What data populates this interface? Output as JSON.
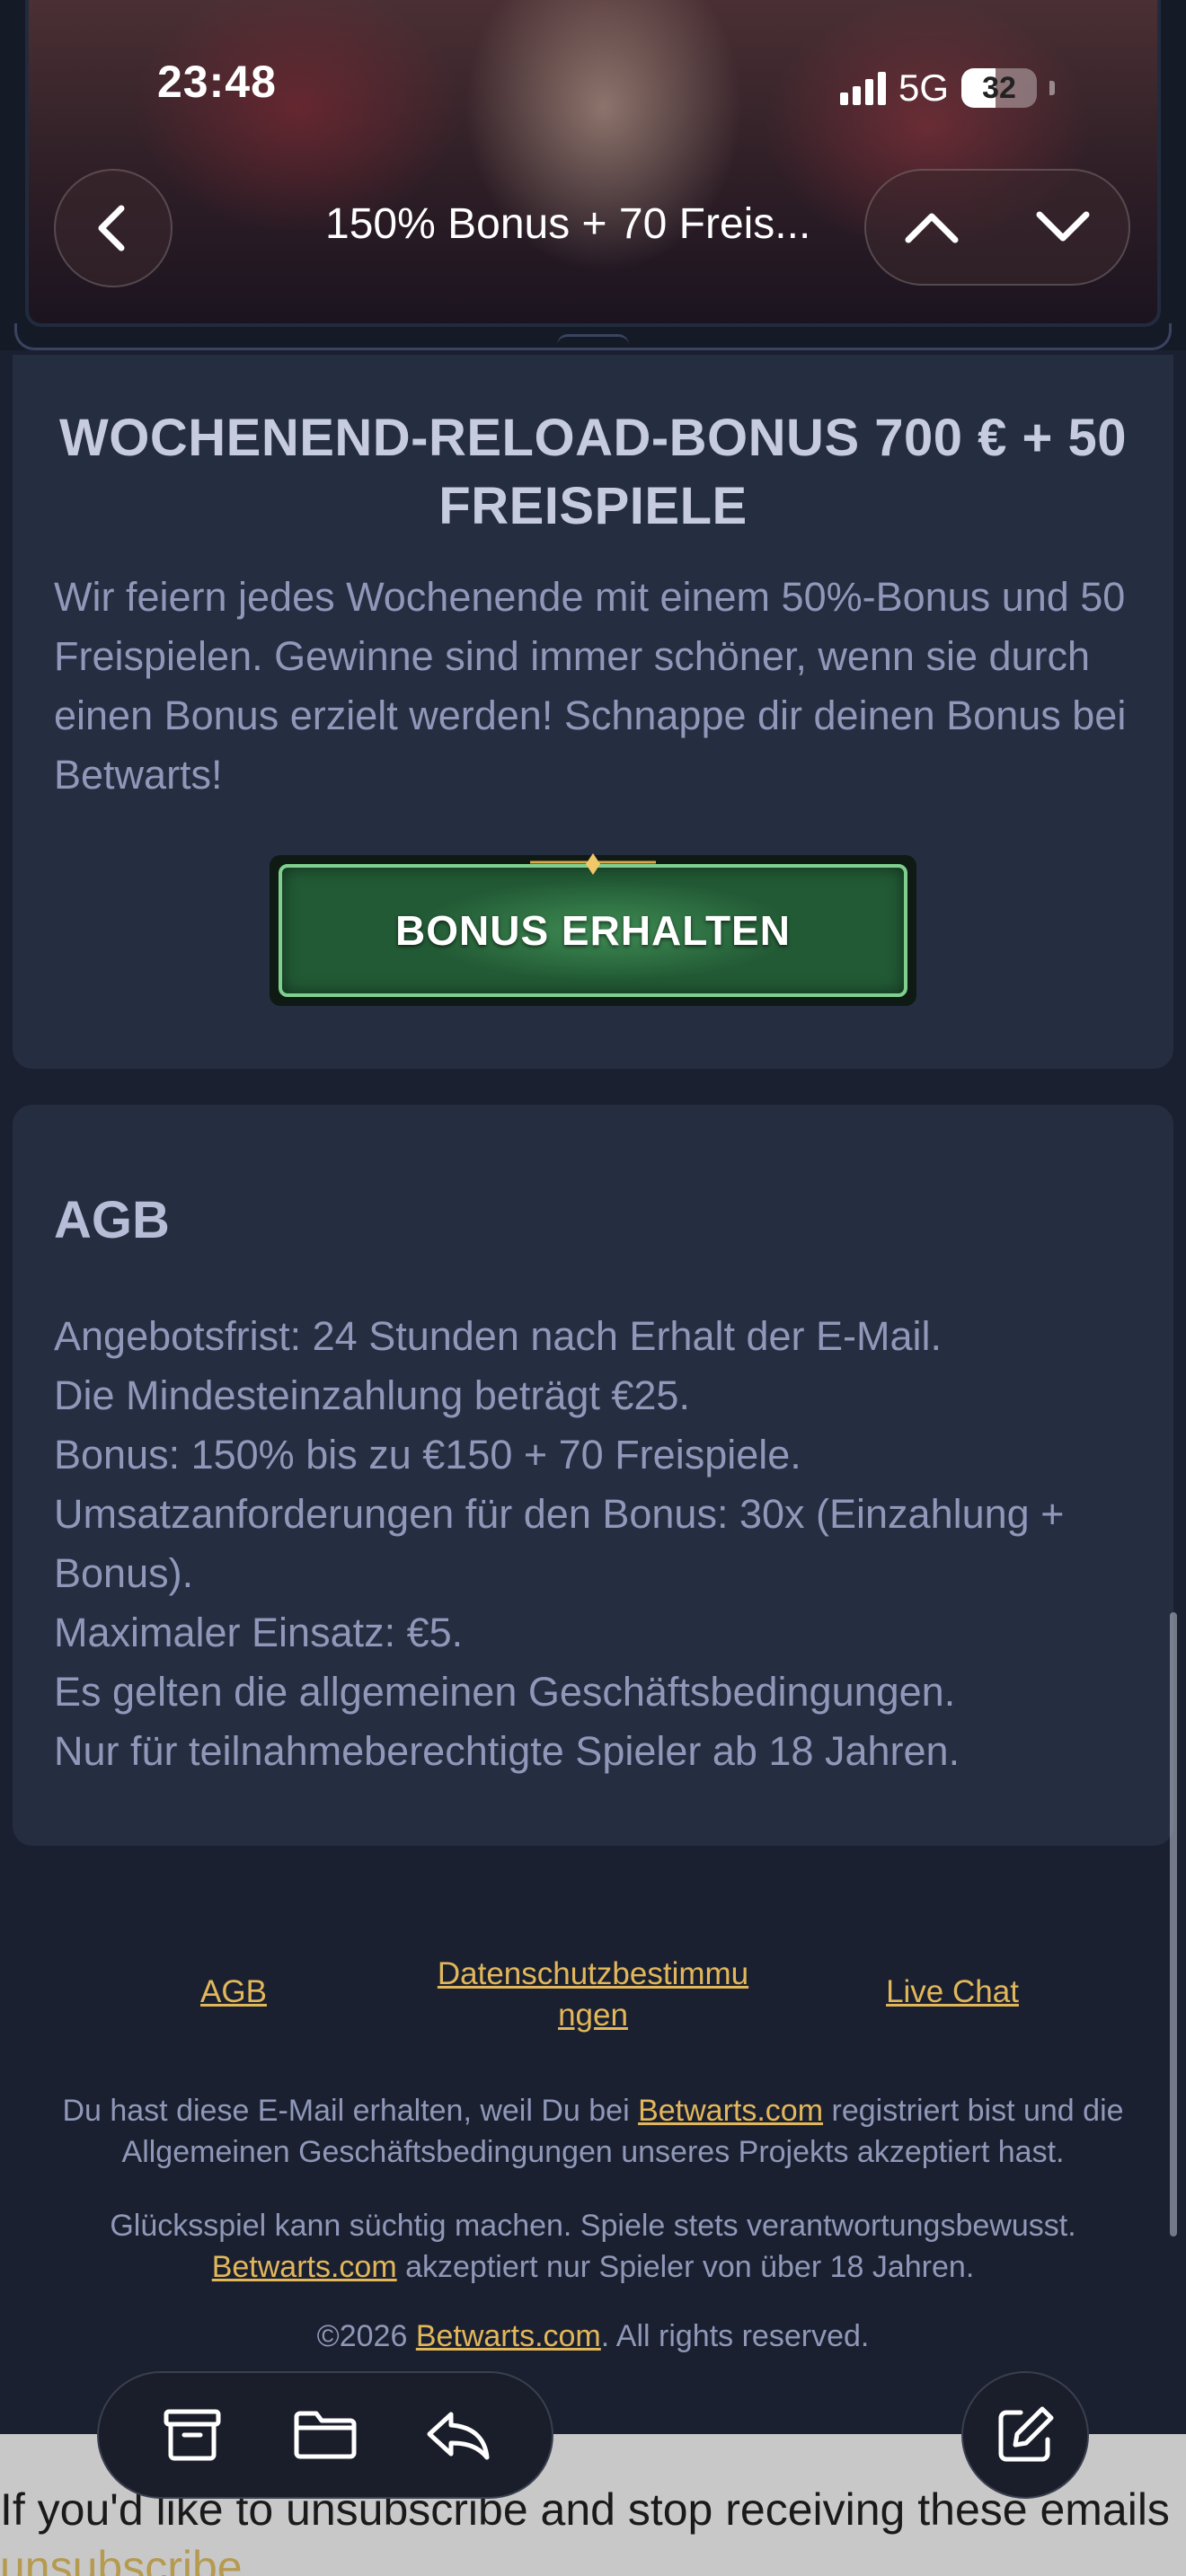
{
  "status_bar": {
    "time": "23:48",
    "network": "5G",
    "battery": "32"
  },
  "nav": {
    "title": "150% Bonus + 70 Freis..."
  },
  "promo": {
    "title": "WOCHENEND-RELOAD-BONUS 700 € + 50 FREISPIELE",
    "body": "Wir feiern jedes Wochenende mit einem 50%-Bonus und 50 Freispielen. Gewinne sind immer schöner, wenn sie durch einen Bonus erzielt werden! Schnappe dir deinen Bonus bei Betwarts!",
    "cta_label": "BONUS ERHALTEN"
  },
  "terms": {
    "title": "AGB",
    "lines": [
      "Angebotsfrist: 24 Stunden nach Erhalt der E-Mail.",
      "Die Mindesteinzahlung beträgt €25.",
      "Bonus: 150% bis zu €150 + 70 Freispiele.",
      "Umsatzanforderungen für den Bonus: 30x (Einzahlung + Bonus).",
      "Maximaler Einsatz: €5.",
      "Es gelten die allgemeinen Geschäftsbedingungen.",
      "Nur für teilnahmeberechtigte Spieler ab 18 Jahren."
    ]
  },
  "footer": {
    "links": {
      "agb": "AGB",
      "privacy_line1": "Datenschutzbestimmu",
      "privacy_line2": "ngen",
      "live_chat": "Live Chat"
    },
    "notice_pre": "Du hast diese E-Mail erhalten, weil Du bei ",
    "notice_link": "Betwarts.com",
    "notice_post": " registriert bist und die Allgemeinen Geschäftsbedingungen unseres Projekts akzeptiert hast.",
    "gambling_pre": "Glücksspiel kann süchtig machen. Spiele stets verantwortungsbewusst. ",
    "gambling_link": "Betwarts.com",
    "gambling_post": " akzeptiert nur Spieler von über 18 Jahren.",
    "copyright_pre": "©2026 ",
    "copyright_link": "Betwarts.com",
    "copyright_post": ". All rights reserved."
  },
  "unsubscribe": {
    "text": "If you'd like to unsubscribe and stop receiving these emails ",
    "link": "unsubscribe"
  },
  "toolbar": {
    "icons": [
      "archive-icon",
      "folder-icon",
      "reply-icon",
      "compose-icon"
    ]
  },
  "colors": {
    "background": "#1b2030",
    "card": "#252d41",
    "link": "#e2b75a",
    "cta_green": "#225a35"
  }
}
